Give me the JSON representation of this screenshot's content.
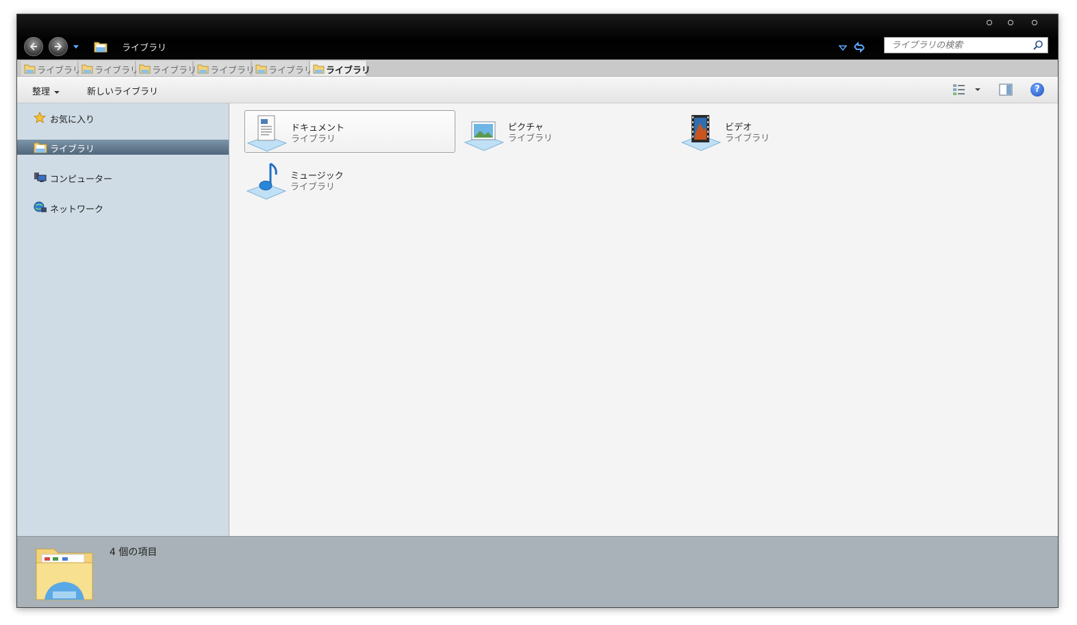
{
  "address": {
    "path": "ライブラリ"
  },
  "search": {
    "placeholder": "ライブラリの検索"
  },
  "tabs": [
    {
      "label": "ライブラリ",
      "active": false
    },
    {
      "label": "ライブラリ",
      "active": false
    },
    {
      "label": "ライブラリ",
      "active": false
    },
    {
      "label": "ライブラリ",
      "active": false
    },
    {
      "label": "ライブラリ",
      "active": false
    },
    {
      "label": "ライブラリ",
      "active": true
    }
  ],
  "toolbar": {
    "organize_label": "整理",
    "new_library_label": "新しいライブラリ",
    "help_label": "?"
  },
  "sidebar": {
    "items": [
      {
        "label": "お気に入り",
        "icon": "star-icon"
      },
      {
        "label": "ライブラリ",
        "icon": "library-folder-icon",
        "selected": true
      },
      {
        "label": "コンピューター",
        "icon": "computer-icon"
      },
      {
        "label": "ネットワーク",
        "icon": "network-icon"
      }
    ]
  },
  "libraries": [
    {
      "name": "ドキュメント",
      "type": "ライブラリ",
      "icon": "documents-icon",
      "selected": true
    },
    {
      "name": "ピクチャ",
      "type": "ライブラリ",
      "icon": "pictures-icon"
    },
    {
      "name": "ビデオ",
      "type": "ライブラリ",
      "icon": "video-icon"
    },
    {
      "name": "ミュージック",
      "type": "ライブラリ",
      "icon": "music-icon"
    }
  ],
  "details": {
    "item_count": "4 個の項目"
  },
  "colors": {
    "accent": "#5aa8ff",
    "sidebar_bg": "#cfdce6",
    "details_bg": "#a8b2b8",
    "titlebar_bg": "#000000"
  }
}
